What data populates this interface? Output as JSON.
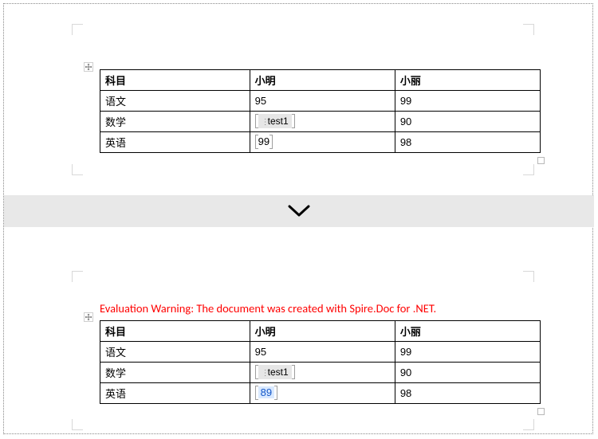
{
  "tables": {
    "before": {
      "headers": [
        "科目",
        "小明",
        "小丽"
      ],
      "rows": [
        {
          "subject": "语文",
          "xiaoming": "95",
          "xiaoli": "99"
        },
        {
          "subject": "数学",
          "xiaoming_field": "test1",
          "xiaoli": "90"
        },
        {
          "subject": "英语",
          "xiaoming": "99",
          "xiaoli": "98"
        }
      ]
    },
    "after": {
      "headers": [
        "科目",
        "小明",
        "小丽"
      ],
      "rows": [
        {
          "subject": "语文",
          "xiaoming": "95",
          "xiaoli": "99"
        },
        {
          "subject": "数学",
          "xiaoming_field": "test1",
          "xiaoli": "90"
        },
        {
          "subject": "英语",
          "xiaoming": "89",
          "xiaoli": "98"
        }
      ]
    }
  },
  "eval_warning": "Evaluation Warning: The document was created with Spire.Doc for .NET.",
  "grip_glyph": "⋮⋮"
}
